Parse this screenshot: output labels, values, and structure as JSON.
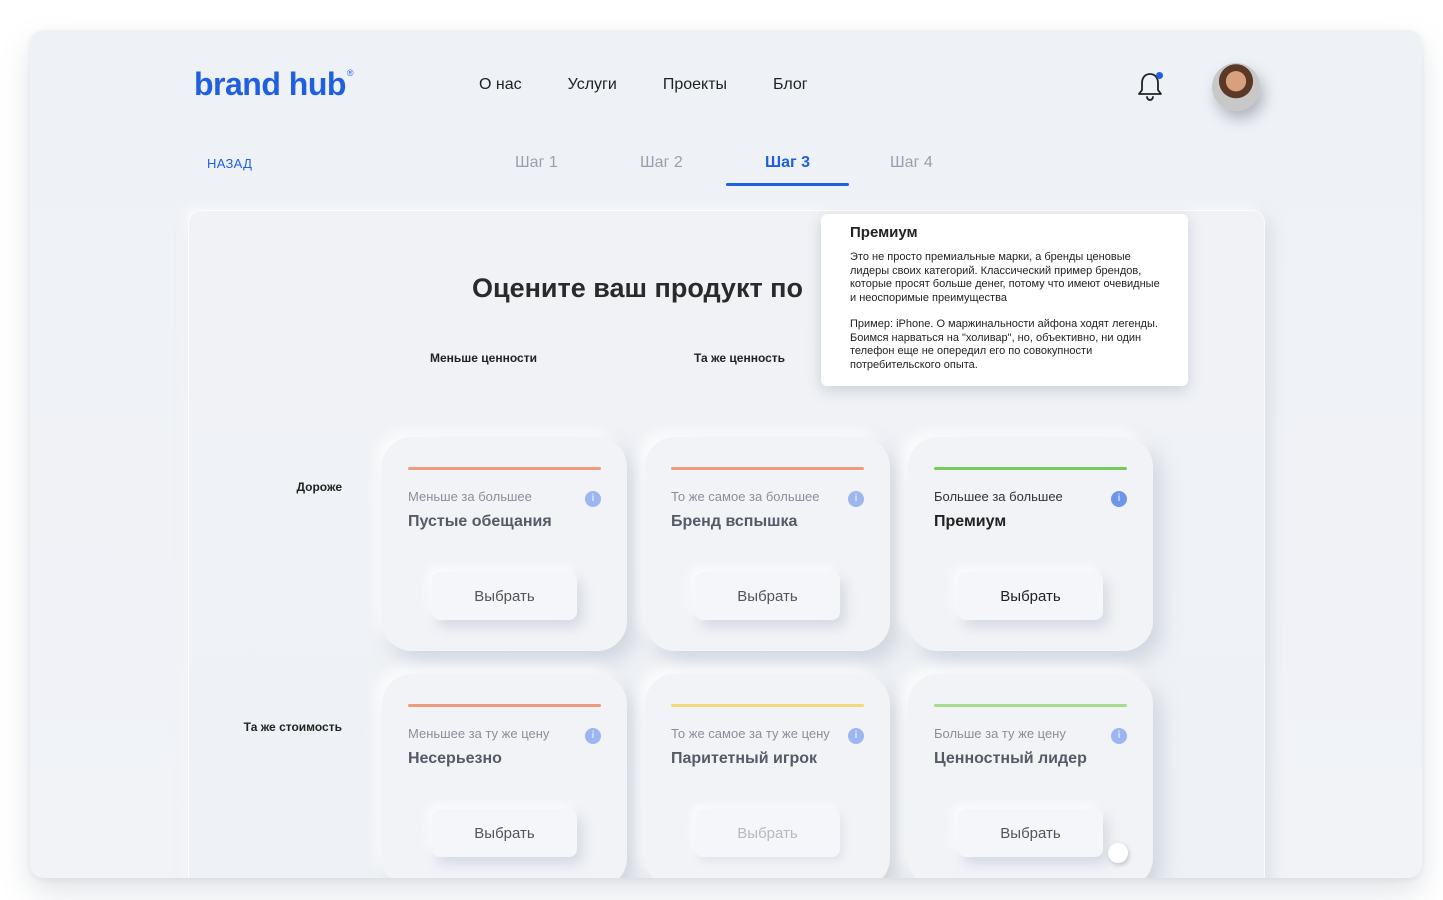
{
  "brand": {
    "name": "brand hub",
    "mark": "®"
  },
  "nav": {
    "items": [
      "О нас",
      "Услуги",
      "Проекты",
      "Блог"
    ]
  },
  "steps": {
    "back": "НАЗАД",
    "items": [
      "Шаг 1",
      "Шаг 2",
      "Шаг 3",
      "Шаг 4"
    ],
    "active": 2
  },
  "main": {
    "heading": "Оцените ваш продукт по ",
    "columns": [
      "Меньше ценности",
      "Та же ценность"
    ],
    "rows": [
      "Дороже",
      "Та же стоимость"
    ],
    "cards": [
      {
        "sub": "Меньше за большее",
        "title": "Пустые обещания",
        "button": "Выбрать",
        "bar_color": "#ef9a78"
      },
      {
        "sub": "То же самое за большее",
        "title": "Бренд вспышка",
        "button": "Выбрать",
        "bar_color": "#ef9a78"
      },
      {
        "sub": "Большее за большее",
        "title": "Премиум",
        "button": "Выбрать",
        "bar_color": "#76cc5a"
      },
      {
        "sub": "Меньшее за ту же цену",
        "title": "Несерьезно",
        "button": "Выбрать",
        "bar_color": "#ef9a78"
      },
      {
        "sub": "То же самое за ту же цену",
        "title": "Паритетный игрок",
        "button": "Выбрать",
        "bar_color": "#f3d880"
      },
      {
        "sub": "Больше за ту же цену",
        "title": "Ценностный лидер",
        "button": "Выбрать",
        "bar_color": "#a6dc8e"
      }
    ],
    "info_glyph": "i"
  },
  "tooltip": {
    "title": "Премиум",
    "paragraph1": "Это не просто премиальные марки, а бренды ценовые лидеры своих категорий. Классический пример брендов, которые просят больше денег, потому что имеют очевидные и неоспоримые преимущества",
    "paragraph2": "Пример: iPhone. О маржинальности айфона ходят легенды. Боимся нарваться на \"холивар\", но, объективно, ни один телефон еще не опередил его по совокупности потребительского опыта."
  },
  "colors": {
    "accent": "#1f5fe0"
  },
  "icons": {
    "notification": "bell-icon",
    "info": "info-icon"
  }
}
